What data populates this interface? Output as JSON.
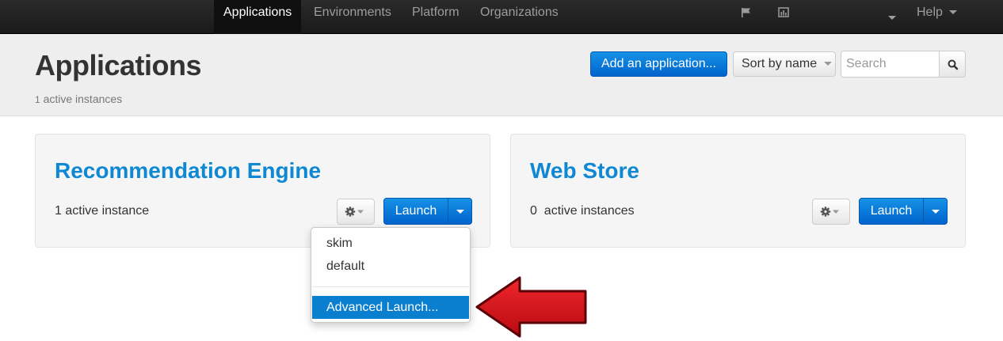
{
  "nav": {
    "items": [
      "Applications",
      "Environments",
      "Platform",
      "Organizations"
    ],
    "help": "Help"
  },
  "header": {
    "title": "Applications",
    "active_instances_count": "1",
    "active_instances_label": "active instances",
    "add_button": "Add an application...",
    "sort_button": "Sort by name",
    "search_placeholder": "Search"
  },
  "cards": [
    {
      "title": "Recommendation Engine",
      "status": "1 active instance",
      "launch_label": "Launch"
    },
    {
      "title": "Web Store",
      "status": "0  active instances",
      "launch_label": "Launch"
    }
  ],
  "dropdown": {
    "items": [
      "skim",
      "default"
    ],
    "advanced": "Advanced Launch..."
  },
  "colors": {
    "primary": "#0070d8",
    "title_blue": "#0e88d3",
    "annotation_arrow": "#d0131a"
  }
}
